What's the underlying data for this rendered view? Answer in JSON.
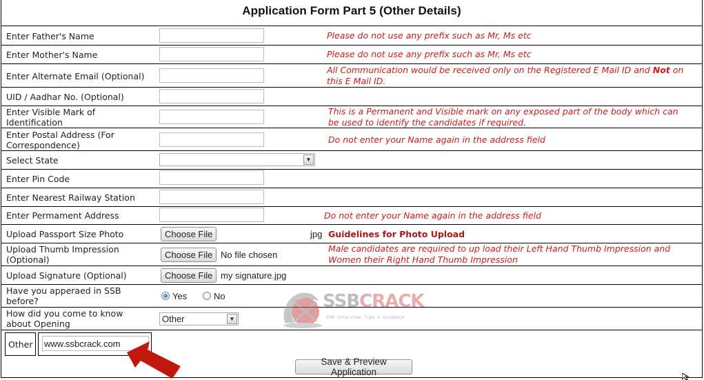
{
  "form": {
    "title": "Application Form Part 5 (Other Details)",
    "fields": {
      "father_name": {
        "label": "Enter Father's Name",
        "value": "",
        "note": "Please do not use any prefix such as Mr, Ms etc"
      },
      "mother_name": {
        "label": "Enter Mother's Name",
        "value": "",
        "note": "Please do not use any prefix such as Mr, Ms etc"
      },
      "alternate_email": {
        "label": "Enter Alternate Email (Optional)",
        "value": "",
        "note_part1": "All Communication would be received only on the Registered E Mail ID and ",
        "note_bold": "Not",
        "note_part2": " on",
        "note_line2": "this E Mail ID."
      },
      "aadhar": {
        "label": "UID / Aadhar No. (Optional)",
        "value": ""
      },
      "visible_mark": {
        "label_line1": "Enter Visible Mark of",
        "label_line2": "Identification",
        "value": "",
        "note_line1": "This is a Permanent and Visible mark on any exposed part of the body which can",
        "note_line2": "be used to identify the candidates if required."
      },
      "postal_address": {
        "label_line1": "Enter Postal Address (For",
        "label_line2": "Correspondence)",
        "value": "",
        "note": "Do not enter your Name again in the address field"
      },
      "state": {
        "label": "Select State",
        "selected": ""
      },
      "pin_code": {
        "label": "Enter Pin Code",
        "value": ""
      },
      "railway_station": {
        "label": "Enter Nearest Railway Station",
        "value": ""
      },
      "permanent_address": {
        "label": "Enter Permament Address",
        "value": "",
        "note": "Do not enter your Name again in the address field"
      },
      "passport_photo": {
        "label": "Upload Passport Size Photo",
        "button": "Choose File",
        "file_name": "jpg",
        "link": "Guidelines for Photo Upload"
      },
      "thumb": {
        "label_line1": "Upload Thumb Impression",
        "label_line2": "(Optional)",
        "button": "Choose File",
        "file_name": "No file chosen",
        "note_line1": "Male candidates are required to up load their Left Hand Thumb Impression and",
        "note_line2": "Women their Right Hand Thumb Impression"
      },
      "signature": {
        "label": "Upload Signature (Optional)",
        "button": "Choose File",
        "file_name": "my signature.jpg"
      },
      "appeared_ssb": {
        "label_line1": "Have you apperaed in SSB",
        "label_line2": "before?",
        "options": [
          "Yes",
          "No"
        ],
        "selected": "Yes"
      },
      "source": {
        "label_line1": "How did you come to know",
        "label_line2": "about Opening",
        "selected": "Other"
      },
      "other": {
        "label": "Other",
        "value": "www.ssbcrack.com"
      }
    },
    "submit_label": "Save & Preview Application"
  },
  "watermark": {
    "brand_part1": "SSB",
    "brand_part2": "CRACK",
    "tagline": "SSB Interview Tips & Guidance"
  },
  "colors": {
    "note_red": "#cc1b1b",
    "link_red": "#b01515",
    "arrow_red": "#c0180c"
  }
}
